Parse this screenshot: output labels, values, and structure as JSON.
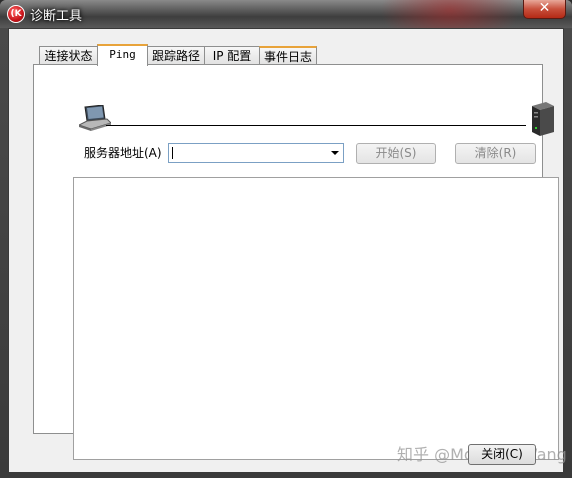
{
  "window": {
    "title": "诊断工具",
    "app_icon_text": "(K",
    "close_glyph": "✕"
  },
  "tabs": [
    {
      "label": "连接状态"
    },
    {
      "label": "Ping"
    },
    {
      "label": "跟踪路径"
    },
    {
      "label": "IP 配置"
    },
    {
      "label": "事件日志"
    }
  ],
  "ping": {
    "server_label": "服务器地址(A)",
    "server_value": "",
    "start_button": "开始(S)",
    "clear_button": "清除(R)"
  },
  "footer": {
    "close_button": "关闭(C)",
    "watermark": "知乎 @Moriarty Wang"
  },
  "icons": {
    "pc": "laptop-icon",
    "server": "server-icon"
  },
  "colors": {
    "active_tab_accent": "#e8a33a",
    "close_button": "#c8503c"
  }
}
